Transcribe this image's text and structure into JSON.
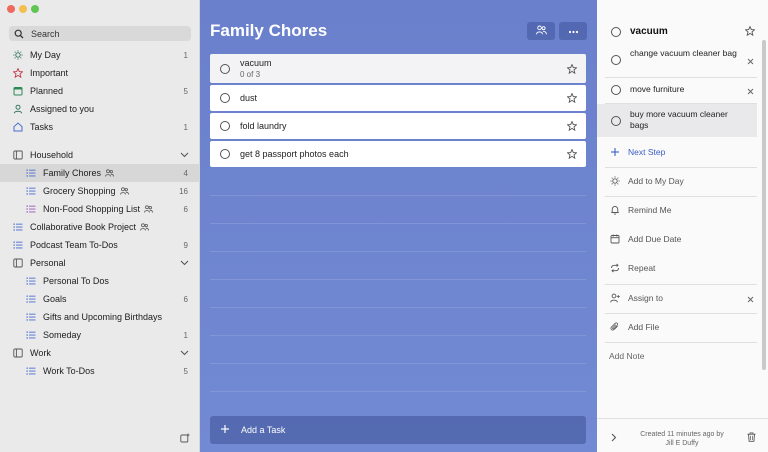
{
  "window": {
    "traffic_colors": [
      "#ee6a5f",
      "#f5bf4f",
      "#61c554"
    ]
  },
  "search": {
    "label": "Search"
  },
  "smart_lists": [
    {
      "label": "My Day",
      "count": "1",
      "icon": "sun-icon",
      "color": "#3a7a62"
    },
    {
      "label": "Important",
      "count": "",
      "icon": "star-icon",
      "color": "#c23a4a"
    },
    {
      "label": "Planned",
      "count": "5",
      "icon": "calendar-icon",
      "color": "#2c8a55"
    },
    {
      "label": "Assigned to you",
      "count": "",
      "icon": "person-icon",
      "color": "#3a7a62"
    },
    {
      "label": "Tasks",
      "count": "1",
      "icon": "home-icon",
      "color": "#4b6fd0"
    }
  ],
  "groups": {
    "household": {
      "label": "Household"
    },
    "personal": {
      "label": "Personal"
    },
    "work": {
      "label": "Work"
    }
  },
  "lists": {
    "family_chores": {
      "label": "Family Chores",
      "count": "4"
    },
    "grocery": {
      "label": "Grocery Shopping",
      "count": "16"
    },
    "nonfood": {
      "label": "Non-Food Shopping List",
      "count": "6"
    },
    "book": {
      "label": "Collaborative Book Project",
      "count": ""
    },
    "podcast": {
      "label": "Podcast Team To-Dos",
      "count": "9"
    },
    "personal_todos": {
      "label": "Personal To Dos",
      "count": ""
    },
    "goals": {
      "label": "Goals",
      "count": "6"
    },
    "gifts": {
      "label": "Gifts and Upcoming Birthdays",
      "count": ""
    },
    "someday": {
      "label": "Someday",
      "count": "1"
    },
    "work_todos": {
      "label": "Work To-Dos",
      "count": "5"
    }
  },
  "main": {
    "title": "Family Chores",
    "background": "#6a80cc",
    "tasks": [
      {
        "title": "vacuum",
        "subtitle": "0 of 3"
      },
      {
        "title": "dust",
        "subtitle": ""
      },
      {
        "title": "fold laundry",
        "subtitle": ""
      },
      {
        "title": "get 8 passport photos each",
        "subtitle": ""
      }
    ],
    "add_task": "Add a Task"
  },
  "detail": {
    "title": "vacuum",
    "steps": [
      {
        "text": "change vacuum cleaner bag"
      },
      {
        "text": "move furniture"
      },
      {
        "text": "buy more vacuum cleaner bags"
      }
    ],
    "next_step": "Next Step",
    "add_to_my_day": "Add to My Day",
    "remind_me": "Remind Me",
    "add_due_date": "Add Due Date",
    "repeat": "Repeat",
    "assign_to": "Assign to",
    "add_file": "Add File",
    "add_note": "Add Note",
    "created_line1": "Created 11 minutes ago by",
    "created_line2": "Jill E Duffy"
  }
}
